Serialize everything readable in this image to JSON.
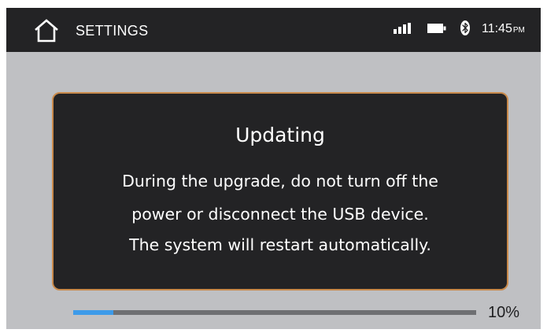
{
  "status_bar": {
    "title": "SETTINGS",
    "time": "11:45",
    "ampm": "PM",
    "icons": [
      "home-icon",
      "signal-icon",
      "battery-icon",
      "bluetooth-icon"
    ]
  },
  "dialog": {
    "title": "Updating",
    "lines": [
      "During the upgrade, do not turn off the",
      "power or disconnect the USB device.",
      "The system will restart automatically."
    ]
  },
  "progress": {
    "percent": 10,
    "label": "10%"
  },
  "colors": {
    "background": "#bfc0c3",
    "bar_background": "#232325",
    "dialog_border": "#c98a4b",
    "progress_fill": "#3d9be9",
    "progress_track": "#6e6f72"
  }
}
